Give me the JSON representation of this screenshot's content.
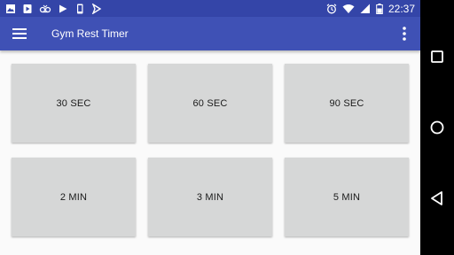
{
  "status_bar": {
    "time": "22:37",
    "icons": [
      "image-icon",
      "play-store-icon",
      "voicemail-icon",
      "play-icon",
      "phone-icon",
      "flash-icon",
      "alarm-icon",
      "wifi-icon",
      "signal-icon",
      "battery-icon"
    ]
  },
  "app_bar": {
    "title": "Gym Rest Timer",
    "menu_icon": "hamburger-menu-icon",
    "overflow_icon": "more-vert-icon"
  },
  "timers": [
    {
      "label": "30 SEC"
    },
    {
      "label": "60 SEC"
    },
    {
      "label": "90 SEC"
    },
    {
      "label": "2 MIN"
    },
    {
      "label": "3 MIN"
    },
    {
      "label": "5 MIN"
    }
  ],
  "nav_bar": {
    "buttons": [
      "recents-square-icon",
      "home-circle-icon",
      "back-triangle-icon"
    ]
  },
  "colors": {
    "status_bar": "#3445a8",
    "app_bar": "#3f51b5",
    "tile": "#d6d7d7",
    "background": "#fafafa"
  }
}
